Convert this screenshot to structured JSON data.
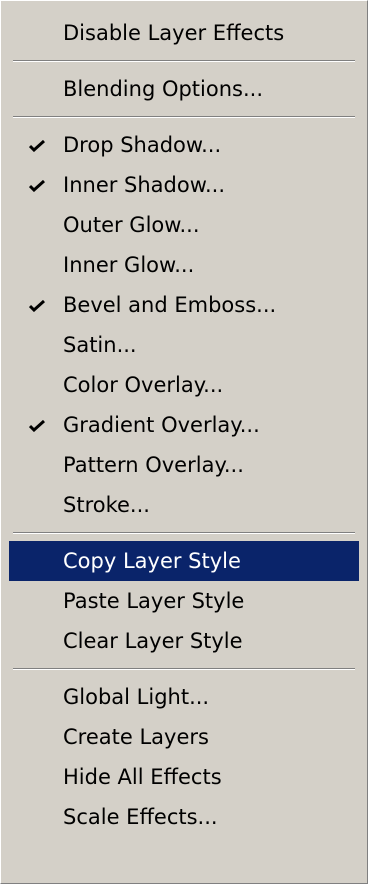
{
  "menu": {
    "items": [
      {
        "label": "Disable Layer Effects",
        "checked": false
      },
      {
        "label": "Blending Options...",
        "checked": false
      },
      {
        "label": "Drop Shadow...",
        "checked": true
      },
      {
        "label": "Inner Shadow...",
        "checked": true
      },
      {
        "label": "Outer Glow...",
        "checked": false
      },
      {
        "label": "Inner Glow...",
        "checked": false
      },
      {
        "label": "Bevel and Emboss...",
        "checked": true
      },
      {
        "label": "Satin...",
        "checked": false
      },
      {
        "label": "Color Overlay...",
        "checked": false
      },
      {
        "label": "Gradient Overlay...",
        "checked": true
      },
      {
        "label": "Pattern Overlay...",
        "checked": false
      },
      {
        "label": "Stroke...",
        "checked": false
      },
      {
        "label": "Copy Layer Style",
        "checked": false,
        "selected": true
      },
      {
        "label": "Paste Layer Style",
        "checked": false
      },
      {
        "label": "Clear Layer Style",
        "checked": false
      },
      {
        "label": "Global Light...",
        "checked": false
      },
      {
        "label": "Create Layers",
        "checked": false
      },
      {
        "label": "Hide All Effects",
        "checked": false
      },
      {
        "label": "Scale Effects...",
        "checked": false
      }
    ],
    "check_icon": "checkmark-icon",
    "colors": {
      "background": "#d4d0c8",
      "highlight": "#0a246a",
      "highlight_text": "#ffffff",
      "text": "#000000"
    }
  }
}
